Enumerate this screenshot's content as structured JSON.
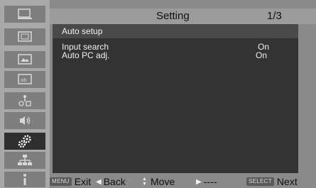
{
  "header": {
    "title": "Setting",
    "page": "1/3"
  },
  "sidebar": {
    "items": [
      {
        "icon": "screen-icon",
        "active": false
      },
      {
        "icon": "pc-adjust-icon",
        "active": false
      },
      {
        "icon": "picture-icon",
        "active": false
      },
      {
        "icon": "image-adjust-icon",
        "active": false
      },
      {
        "icon": "input-source-icon",
        "active": false
      },
      {
        "icon": "sound-icon",
        "active": false
      },
      {
        "icon": "setting-gears-icon",
        "active": true
      },
      {
        "icon": "network-icon",
        "active": false
      },
      {
        "icon": "info-icon",
        "active": false
      }
    ]
  },
  "panel": {
    "heading": "Auto setup",
    "rows": [
      {
        "label": "Input search",
        "value": "On"
      },
      {
        "label": "Auto PC adj.",
        "value": "On"
      }
    ]
  },
  "footer": {
    "exit_key": "MENU",
    "exit_label": "Exit",
    "back_glyph": "◀",
    "back_label": "Back",
    "move_glyph": "▲▼",
    "move_label": "Move",
    "next_glyph": "▶",
    "next_label": "----",
    "select_key": "SELECT",
    "select_label": "Next"
  },
  "colors": {
    "panel_bg": "#333333",
    "panel_heading_bg": "#4a4a4a",
    "sidebar_bg": "#a8a8a8",
    "sidebar_item_bg": "#7e7e7e",
    "sidebar_active_bg": "#2e2e2e",
    "frame_bg": "#8a8a8a"
  }
}
